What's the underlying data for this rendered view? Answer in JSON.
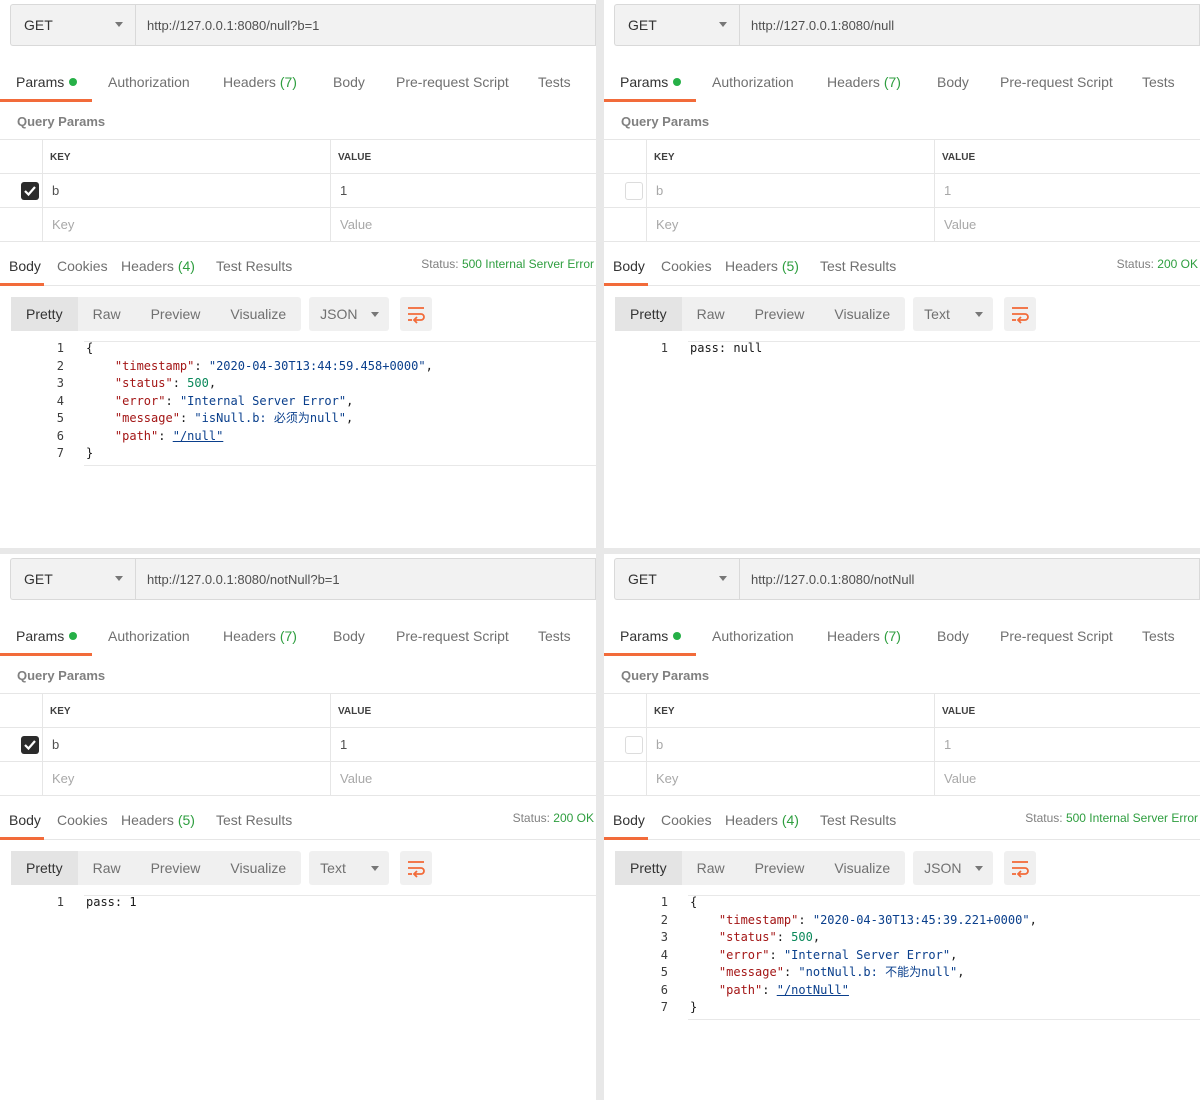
{
  "common": {
    "tabs": {
      "params": "Params",
      "authorization": "Authorization",
      "headers": "Headers",
      "headers_count": "(7)",
      "body": "Body",
      "prerequest": "Pre-request Script",
      "tests": "Tests"
    },
    "query_params_title": "Query Params",
    "key_header": "KEY",
    "value_header": "VALUE",
    "key_placeholder": "Key",
    "value_placeholder": "Value",
    "res_tabs": {
      "body": "Body",
      "cookies": "Cookies",
      "headers": "Headers",
      "test_results": "Test Results"
    },
    "status_label": "Status:",
    "views": {
      "pretty": "Pretty",
      "raw": "Raw",
      "preview": "Preview",
      "visualize": "Visualize"
    },
    "colors": {
      "accent": "#f26b3a",
      "success": "#2e9e3f",
      "dot": "#26b047"
    }
  },
  "panels": [
    {
      "method": "GET",
      "url": "http://127.0.0.1:8080/null?b=1",
      "param": {
        "checked": true,
        "key": "b",
        "value": "1"
      },
      "res_headers_count": "(4)",
      "status": "500 Internal Server Error",
      "format": "JSON",
      "code": [
        {
          "n": "1",
          "brace": "{"
        },
        {
          "n": "2",
          "key": "\"timestamp\"",
          "val": "\"2020-04-30T13:44:59.458+0000\"",
          "kind": "s",
          "tail": ","
        },
        {
          "n": "3",
          "key": "\"status\"",
          "val": "500",
          "kind": "n",
          "tail": ","
        },
        {
          "n": "4",
          "key": "\"error\"",
          "val": "\"Internal Server Error\"",
          "kind": "s",
          "tail": ","
        },
        {
          "n": "5",
          "key": "\"message\"",
          "val": "\"isNull.b: 必须为null\"",
          "kind": "s",
          "tail": ","
        },
        {
          "n": "6",
          "key": "\"path\"",
          "val": "\"/null\"",
          "kind": "u",
          "tail": ""
        },
        {
          "n": "7",
          "brace": "}"
        }
      ]
    },
    {
      "method": "GET",
      "url": "http://127.0.0.1:8080/null",
      "param": {
        "checked": false,
        "key": "b",
        "value": "1"
      },
      "res_headers_count": "(5)",
      "status": "200 OK",
      "format": "Text",
      "code": [
        {
          "n": "1",
          "text": "pass: null"
        }
      ]
    },
    {
      "method": "GET",
      "url": "http://127.0.0.1:8080/notNull?b=1",
      "param": {
        "checked": true,
        "key": "b",
        "value": "1"
      },
      "res_headers_count": "(5)",
      "status": "200 OK",
      "format": "Text",
      "code": [
        {
          "n": "1",
          "text": "pass: 1"
        }
      ]
    },
    {
      "method": "GET",
      "url": "http://127.0.0.1:8080/notNull",
      "param": {
        "checked": false,
        "key": "b",
        "value": "1"
      },
      "res_headers_count": "(4)",
      "status": "500 Internal Server Error",
      "format": "JSON",
      "code": [
        {
          "n": "1",
          "brace": "{"
        },
        {
          "n": "2",
          "key": "\"timestamp\"",
          "val": "\"2020-04-30T13:45:39.221+0000\"",
          "kind": "s",
          "tail": ","
        },
        {
          "n": "3",
          "key": "\"status\"",
          "val": "500",
          "kind": "n",
          "tail": ","
        },
        {
          "n": "4",
          "key": "\"error\"",
          "val": "\"Internal Server Error\"",
          "kind": "s",
          "tail": ","
        },
        {
          "n": "5",
          "key": "\"message\"",
          "val": "\"notNull.b: 不能为null\"",
          "kind": "s",
          "tail": ","
        },
        {
          "n": "6",
          "key": "\"path\"",
          "val": "\"/notNull\"",
          "kind": "u",
          "tail": ""
        },
        {
          "n": "7",
          "brace": "}"
        }
      ]
    }
  ]
}
